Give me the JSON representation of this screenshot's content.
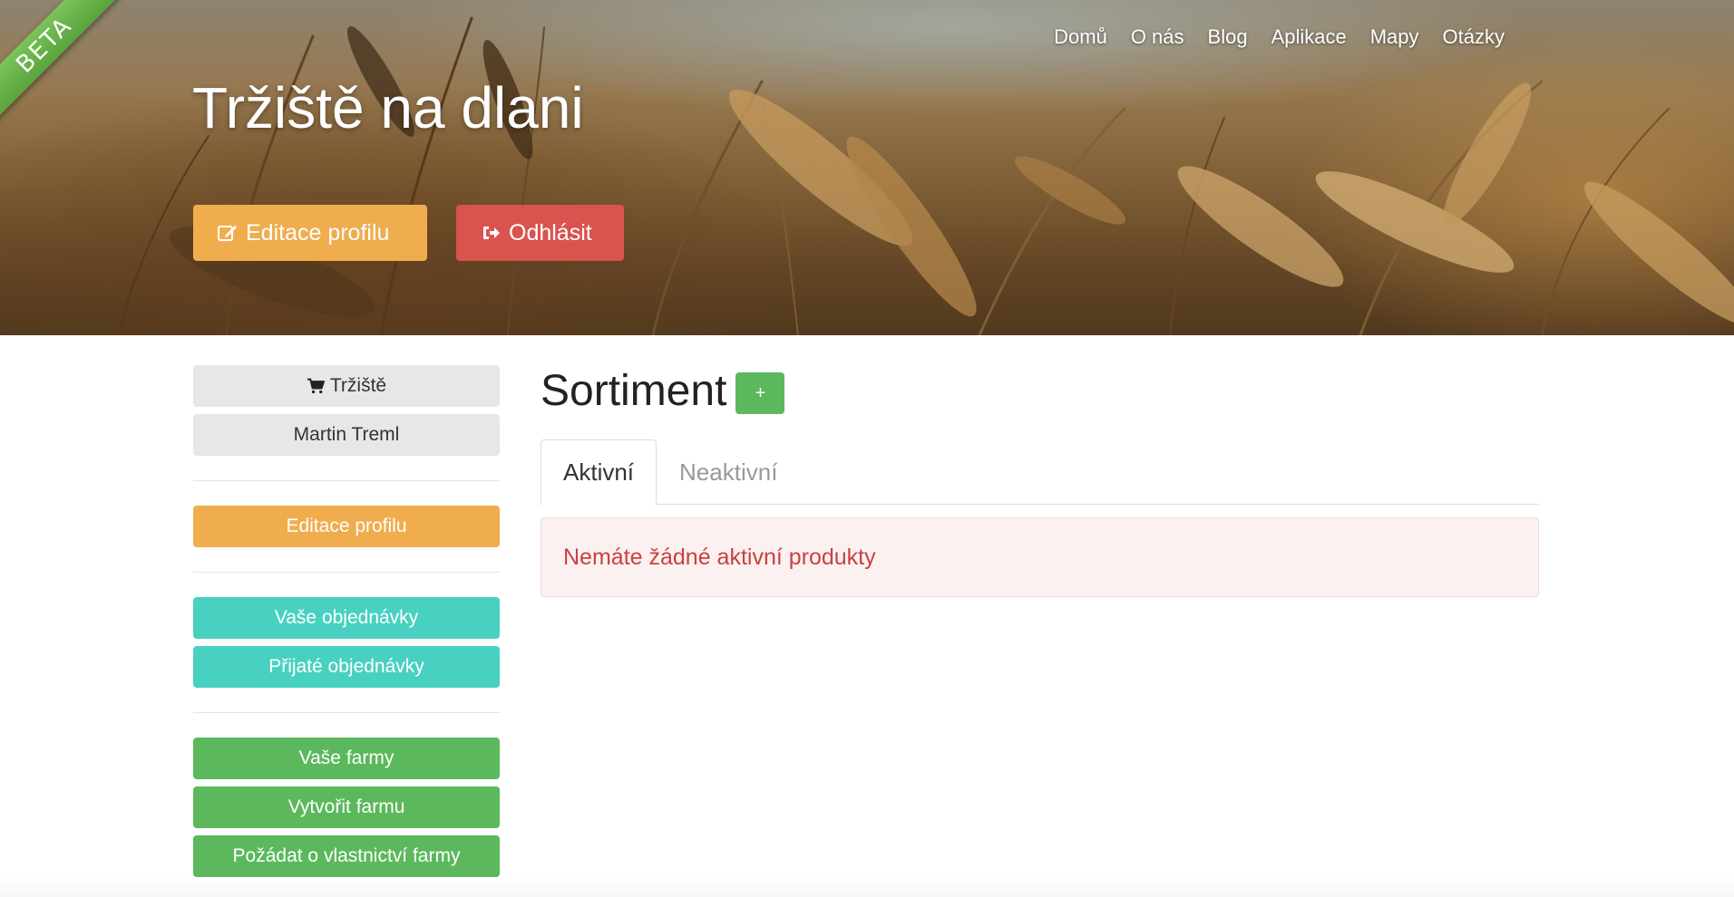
{
  "beta_label": "BETA",
  "nav": {
    "items": [
      {
        "label": "Domů"
      },
      {
        "label": "O nás"
      },
      {
        "label": "Blog"
      },
      {
        "label": "Aplikace"
      },
      {
        "label": "Mapy"
      },
      {
        "label": "Otázky"
      }
    ]
  },
  "hero": {
    "title": "Tržiště na dlani",
    "edit_profile_label": "Editace profilu",
    "logout_label": "Odhlásit"
  },
  "sidebar": {
    "market_label": "Tržiště",
    "user_name": "Martin Treml",
    "edit_profile_label": "Editace profilu",
    "your_orders_label": "Vaše objednávky",
    "received_orders_label": "Přijaté objednávky",
    "your_farms_label": "Vaše farmy",
    "create_farm_label": "Vytvořit farmu",
    "request_ownership_label": "Požádat o vlastnictví farmy"
  },
  "main": {
    "title": "Sortiment",
    "add_label": "+",
    "tabs": [
      {
        "label": "Aktivní",
        "active": true
      },
      {
        "label": "Neaktivní",
        "active": false
      }
    ],
    "alert_text": "Nemáte žádné aktivní produkty"
  },
  "colors": {
    "warning": "#f0ad4e",
    "danger": "#d9534f",
    "teal": "#48d1c0",
    "success": "#5cb85c",
    "beta_ribbon": "#6ab84a"
  },
  "icons": {
    "edit": "pencil-square-icon",
    "logout": "sign-out-icon",
    "market": "shopping-cart-icon"
  }
}
